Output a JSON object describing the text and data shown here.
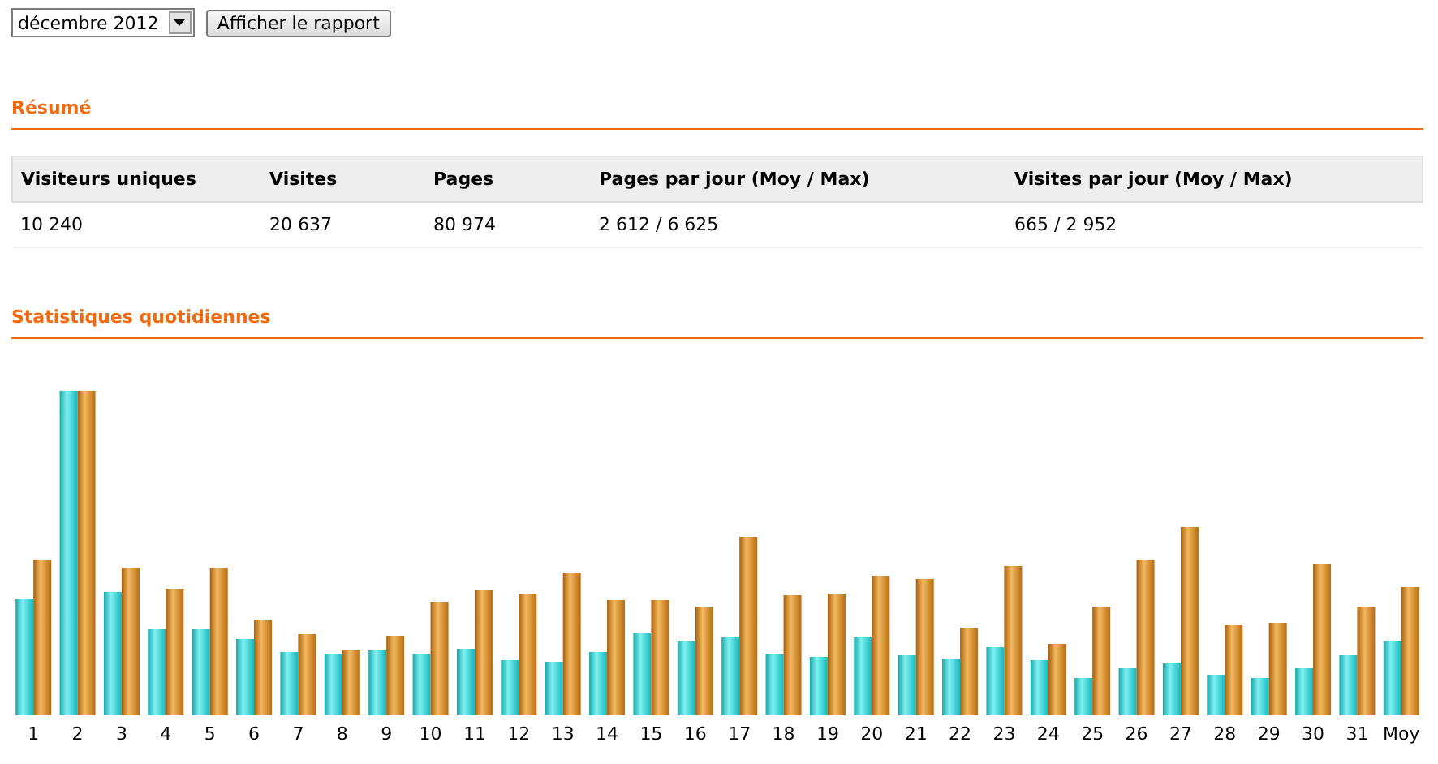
{
  "toolbar": {
    "month": "décembre 2012",
    "button": "Afficher le rapport"
  },
  "summary": {
    "title": "Résumé",
    "columns": [
      "Visiteurs uniques",
      "Visites",
      "Pages",
      "Pages par jour (Moy / Max)",
      "Visites par jour (Moy / Max)"
    ],
    "row": [
      "10 240",
      "20 637",
      "80 974",
      "2 612 / 6 625",
      "665 / 2 952"
    ]
  },
  "daily": {
    "title": "Statistiques quotidiennes",
    "labels": [
      "1",
      "2",
      "3",
      "4",
      "5",
      "6",
      "7",
      "8",
      "9",
      "10",
      "11",
      "12",
      "13",
      "14",
      "15",
      "16",
      "17",
      "18",
      "19",
      "20",
      "21",
      "22",
      "23",
      "24",
      "25",
      "26",
      "27",
      "28",
      "29",
      "30",
      "31",
      "Moy"
    ]
  }
}
